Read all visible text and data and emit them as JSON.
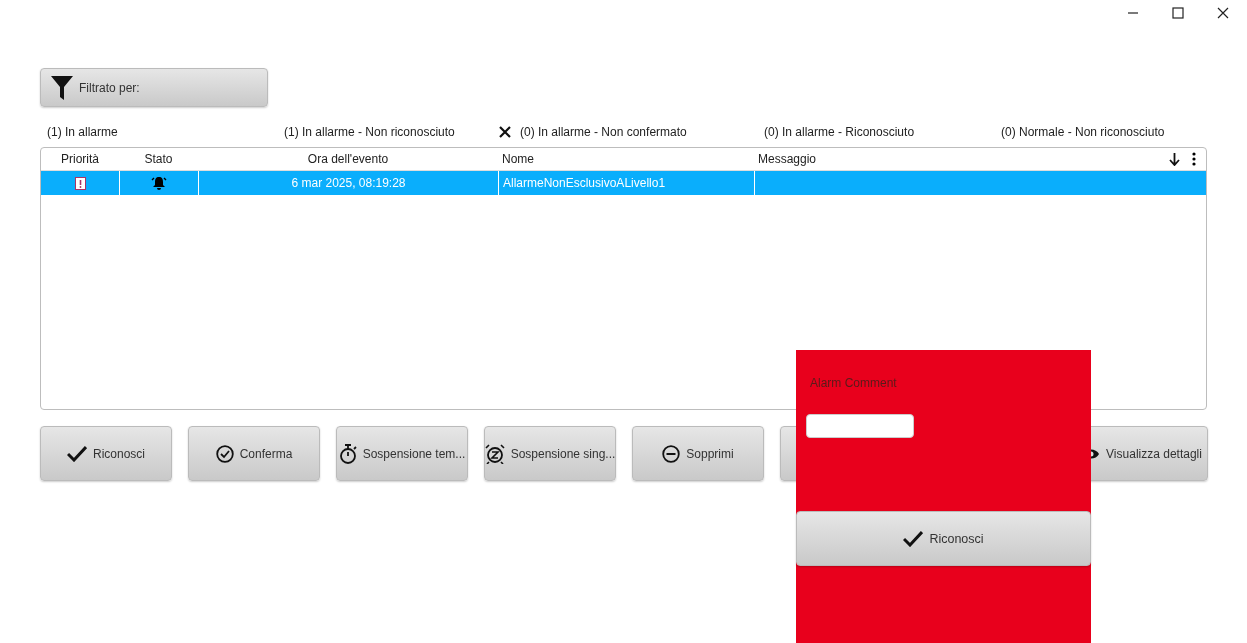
{
  "filter_button": {
    "label": "Filtrato per:"
  },
  "legend": [
    {
      "label": "(1) In allarme",
      "excluded": false
    },
    {
      "label": "(1) In allarme - Non riconosciuto",
      "excluded": false
    },
    {
      "label": "(0) In allarme - Non confermato",
      "excluded": true
    },
    {
      "label": "(0) In allarme - Riconosciuto",
      "excluded": false
    },
    {
      "label": "(0) Normale - Non riconosciuto",
      "excluded": false
    }
  ],
  "table": {
    "columns": [
      "Priorità",
      "Stato",
      "Ora dell'evento",
      "Nome",
      "Messaggio"
    ],
    "rows": [
      {
        "selected": true,
        "event_time": "6 mar 2025, 08:19:28",
        "name": "AllarmeNonEsclusivoALivello1"
      }
    ]
  },
  "buttons": [
    {
      "label": "Riconosci",
      "kind": "acknowledge"
    },
    {
      "label": "Conferma",
      "kind": "confirm"
    },
    {
      "label": "Sospensione tem...",
      "kind": "shelve"
    },
    {
      "label": "Sospensione sing...",
      "kind": "snooze"
    },
    {
      "label": "Sopprimi",
      "kind": "suppress"
    },
    {
      "label": "Visualizza dettagli",
      "kind": "details"
    }
  ],
  "comment_popup": {
    "title": "Alarm Comment",
    "button": {
      "label": "Riconosci"
    }
  }
}
